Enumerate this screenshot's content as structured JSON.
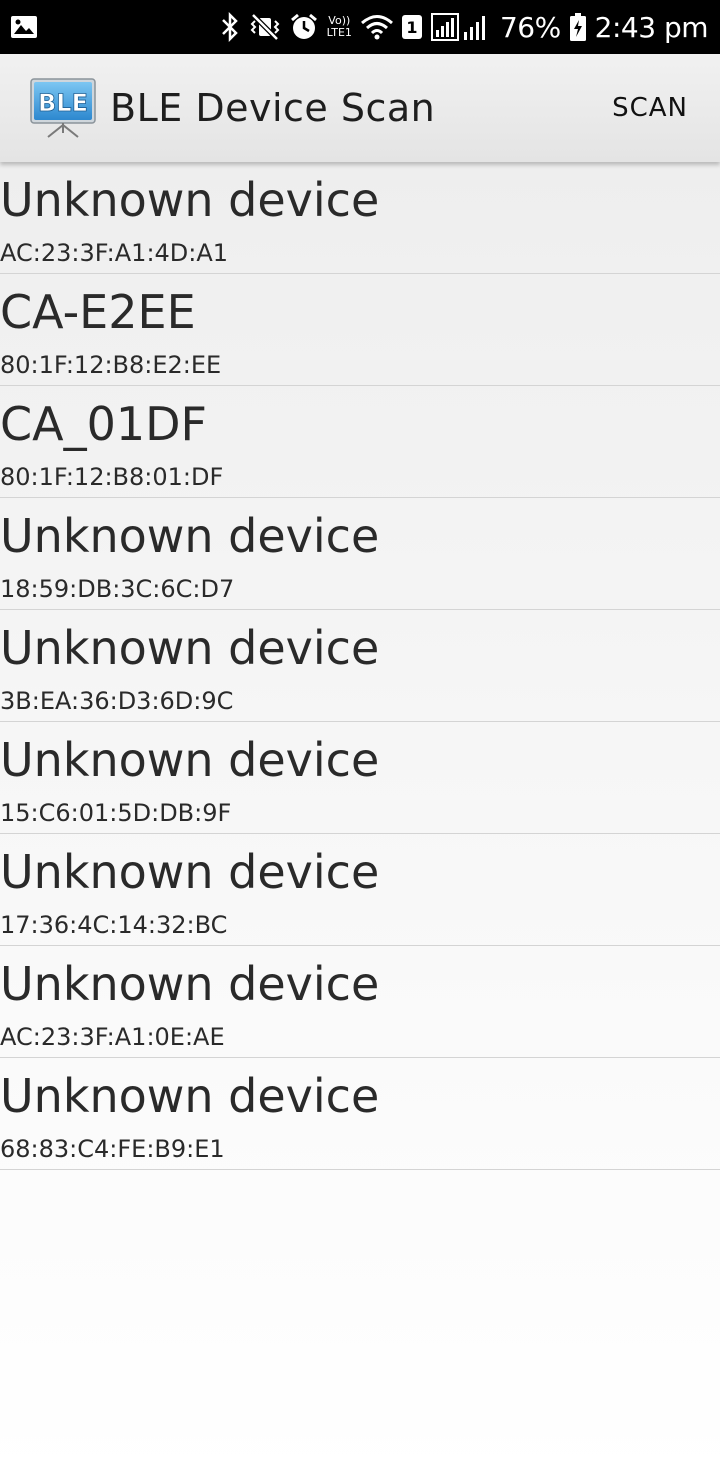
{
  "status_bar": {
    "battery": "76%",
    "time": "2:43 pm",
    "volte_top": "Vo))",
    "volte_bottom": "LTE1",
    "sim": "1",
    "icons": [
      "gallery-icon",
      "bluetooth-icon",
      "vibrate-mute-icon",
      "alarm-icon",
      "wifi-icon",
      "sim-icon",
      "signal-icon",
      "battery-charging-icon"
    ]
  },
  "action_bar": {
    "app_icon_text": "BLE",
    "title": "BLE Device Scan",
    "scan_label": "SCAN"
  },
  "devices": [
    {
      "name": "Unknown device",
      "address": "AC:23:3F:A1:4D:A1"
    },
    {
      "name": "CA-E2EE",
      "address": "80:1F:12:B8:E2:EE"
    },
    {
      "name": "CA_01DF",
      "address": "80:1F:12:B8:01:DF"
    },
    {
      "name": "Unknown device",
      "address": "18:59:DB:3C:6C:D7"
    },
    {
      "name": "Unknown device",
      "address": "3B:EA:36:D3:6D:9C"
    },
    {
      "name": "Unknown device",
      "address": "15:C6:01:5D:DB:9F"
    },
    {
      "name": "Unknown device",
      "address": "17:36:4C:14:32:BC"
    },
    {
      "name": "Unknown device",
      "address": "AC:23:3F:A1:0E:AE"
    },
    {
      "name": "Unknown device",
      "address": "68:83:C4:FE:B9:E1"
    }
  ]
}
